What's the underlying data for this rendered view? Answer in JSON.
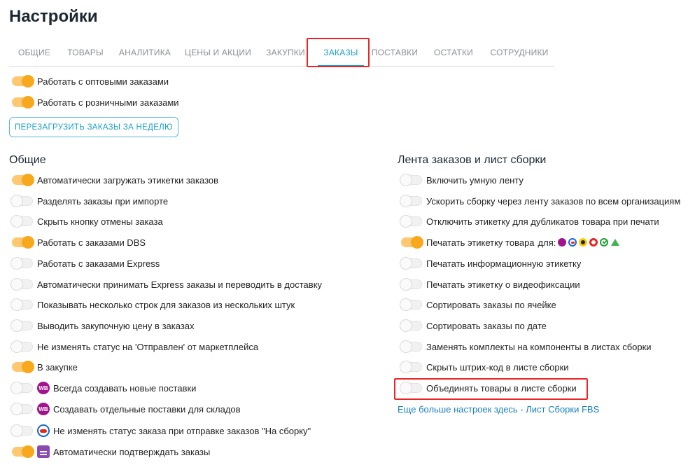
{
  "page": {
    "title": "Настройки"
  },
  "tabs": [
    {
      "label": "ОБЩИЕ"
    },
    {
      "label": "ТОВАРЫ"
    },
    {
      "label": "АНАЛИТИКА"
    },
    {
      "label": "ЦЕНЫ И АКЦИИ"
    },
    {
      "label": "ЗАКУПКИ"
    },
    {
      "label": "ЗАКАЗЫ",
      "active": true
    },
    {
      "label": "ПОСТАВКИ"
    },
    {
      "label": "ОСТАТКИ"
    },
    {
      "label": "СОТРУДНИКИ"
    }
  ],
  "top_toggles": [
    {
      "label": "Работать с оптовыми заказами",
      "on": true
    },
    {
      "label": "Работать с розничными заказами",
      "on": true
    }
  ],
  "reload_button": {
    "label": "ПЕРЕЗАГРУЗИТЬ ЗАКАЗЫ ЗА НЕДЕЛЮ"
  },
  "general": {
    "title": "Общие",
    "items": [
      {
        "label": "Автоматически загружать этикетки заказов",
        "on": true
      },
      {
        "label": "Разделять заказы при импорте",
        "on": false
      },
      {
        "label": "Скрыть кнопку отмены заказа",
        "on": false
      },
      {
        "label": "Работать с заказами DBS",
        "on": true
      },
      {
        "label": "Работать с заказами Express",
        "on": false
      },
      {
        "label": "Автоматически принимать Express заказы и переводить в доставку",
        "on": false
      },
      {
        "label": "Показывать несколько строк для заказов из нескольких штук",
        "on": false
      },
      {
        "label": "Выводить закупочную цену в заказах",
        "on": false
      },
      {
        "label": "Не изменять статус на 'Отправлен' от маркетплейса",
        "on": false
      },
      {
        "label": "В закупке",
        "on": true
      },
      {
        "label": "Всегда создавать новые поставки",
        "on": false,
        "badge": "wb",
        "badge_text": "WB"
      },
      {
        "label": "Создавать отдельные поставки для складов",
        "on": false,
        "badge": "wb",
        "badge_text": "WB"
      },
      {
        "label": "Не изменять статус заказа при отправке заказов \"На сборку\"",
        "on": false,
        "badge": "ozon",
        "badge_text": ""
      },
      {
        "label": "Автоматически подтверждать заказы",
        "on": true,
        "badge": "mm",
        "badge_text": ""
      }
    ]
  },
  "feed": {
    "title": "Лента заказов и лист сборки",
    "items": [
      {
        "label": "Включить умную ленту",
        "on": false
      },
      {
        "label": "Ускорить сборку через ленту заказов по всем организациям",
        "on": false
      },
      {
        "label": "Отключить этикетку для дубликатов товара при печати",
        "on": false
      },
      {
        "label": "Печатать этикетку товара",
        "on": true,
        "suffix": "для:",
        "marketplaces": [
          "wb",
          "ozon",
          "ym",
          "mm",
          "sber",
          "mag"
        ]
      },
      {
        "label": "Печатать информационную этикетку",
        "on": false
      },
      {
        "label": "Печатать этикетку о видеофиксации",
        "on": false
      },
      {
        "label": "Сортировать заказы по ячейке",
        "on": false
      },
      {
        "label": "Сортировать заказы по дате",
        "on": false
      },
      {
        "label": "Заменять комплекты на компоненты в листах сборки",
        "on": false
      },
      {
        "label": "Скрыть штрих-код в листе сборки",
        "on": false
      },
      {
        "label": "Объединять товары в листе сборки",
        "on": false
      }
    ],
    "more_link": "Еще больше настроек здесь - Лист Сборки FBS"
  },
  "colors": {
    "accent": "#1a9fd0",
    "toggle_on": "#f7a81c",
    "highlight": "#e8262a",
    "link": "#1a7fc1"
  }
}
